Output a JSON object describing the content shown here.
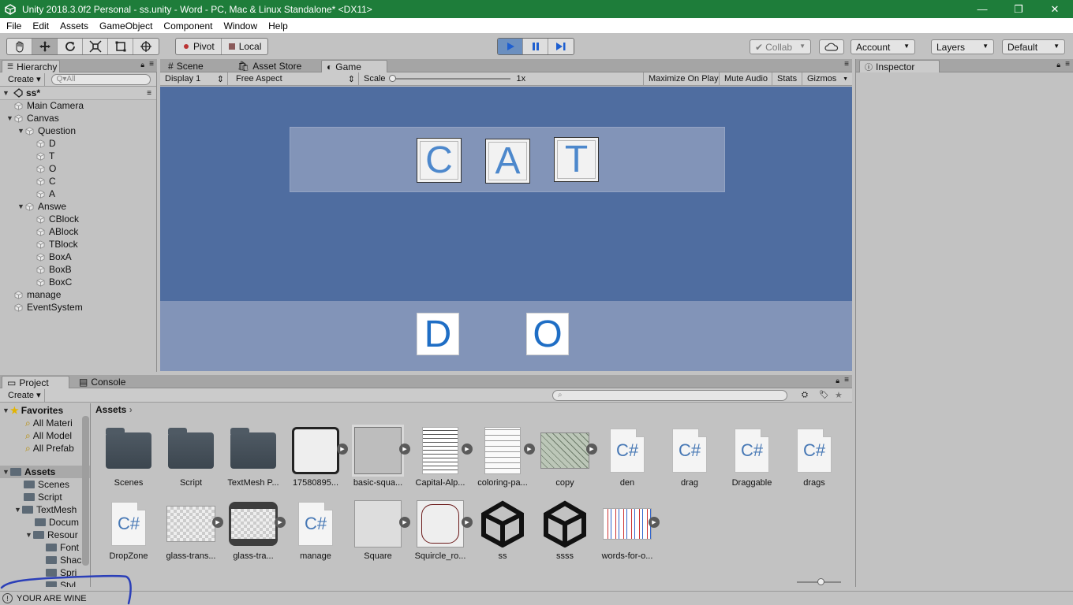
{
  "window": {
    "title": "Unity 2018.3.0f2 Personal - ss.unity - Word - PC, Mac & Linux Standalone* <DX11>",
    "minimize": "—",
    "maximize": "❐",
    "close": "✕"
  },
  "menu": [
    "File",
    "Edit",
    "Assets",
    "GameObject",
    "Component",
    "Window",
    "Help"
  ],
  "toolbar": {
    "pivot": "Pivot",
    "local": "Local",
    "collab": "Collab",
    "account": "Account",
    "layers": "Layers",
    "layout": "Default"
  },
  "hierarchy": {
    "tab": "Hierarchy",
    "create": "Create",
    "search_placeholder": "Q▾All",
    "scene": "ss*",
    "items": [
      {
        "label": "Main Camera",
        "depth": 1,
        "arrow": ""
      },
      {
        "label": "Canvas",
        "depth": 1,
        "arrow": "▼"
      },
      {
        "label": "Question",
        "depth": 2,
        "arrow": "▼"
      },
      {
        "label": "D",
        "depth": 3,
        "arrow": ""
      },
      {
        "label": "T",
        "depth": 3,
        "arrow": ""
      },
      {
        "label": "O",
        "depth": 3,
        "arrow": ""
      },
      {
        "label": "C",
        "depth": 3,
        "arrow": ""
      },
      {
        "label": "A",
        "depth": 3,
        "arrow": ""
      },
      {
        "label": "Answe",
        "depth": 2,
        "arrow": "▼"
      },
      {
        "label": "CBlock",
        "depth": 3,
        "arrow": ""
      },
      {
        "label": "ABlock",
        "depth": 3,
        "arrow": ""
      },
      {
        "label": "TBlock",
        "depth": 3,
        "arrow": ""
      },
      {
        "label": "BoxA",
        "depth": 3,
        "arrow": ""
      },
      {
        "label": "BoxB",
        "depth": 3,
        "arrow": ""
      },
      {
        "label": "BoxC",
        "depth": 3,
        "arrow": ""
      },
      {
        "label": "manage",
        "depth": 1,
        "arrow": ""
      },
      {
        "label": "EventSystem",
        "depth": 1,
        "arrow": ""
      }
    ]
  },
  "views": {
    "tabs": [
      "Scene",
      "Asset Store",
      "Game"
    ],
    "display": "Display 1",
    "aspect": "Free Aspect",
    "scale_label": "Scale",
    "scale_value": "1x",
    "maximize": "Maximize On Play",
    "mute": "Mute Audio",
    "stats": "Stats",
    "gizmos": "Gizmos"
  },
  "game": {
    "question_tiles": [
      "C",
      "A",
      "T"
    ],
    "answer_tiles": [
      "D",
      "O"
    ]
  },
  "inspector": {
    "tab": "Inspector"
  },
  "project": {
    "tabs": [
      "Project",
      "Console"
    ],
    "create": "Create",
    "breadcrumb": "Assets",
    "favorites": {
      "label": "Favorites",
      "items": [
        "All Materi",
        "All Model",
        "All Prefab"
      ]
    },
    "assets_root": "Assets",
    "folders": [
      "Scenes",
      "Script",
      "TextMesh",
      "Docum",
      "Resour",
      "Font",
      "Shac",
      "Spri",
      "Styl"
    ],
    "row1": [
      {
        "label": "Scenes",
        "kind": "folder"
      },
      {
        "label": "Script",
        "kind": "folder"
      },
      {
        "label": "TextMesh P...",
        "kind": "folder"
      },
      {
        "label": "17580895...",
        "kind": "sprite-frame"
      },
      {
        "label": "basic-squa...",
        "kind": "sprite-square"
      },
      {
        "label": "Capital-Alp...",
        "kind": "sprite-letters"
      },
      {
        "label": "coloring-pa...",
        "kind": "sprite-coloring"
      },
      {
        "label": "copy",
        "kind": "sprite-map"
      },
      {
        "label": "den",
        "kind": "csharp"
      },
      {
        "label": "drag",
        "kind": "csharp"
      },
      {
        "label": "Draggable",
        "kind": "csharp"
      },
      {
        "label": "drags",
        "kind": "csharp"
      }
    ],
    "row2": [
      {
        "label": "DropZone",
        "kind": "csharp"
      },
      {
        "label": "glass-trans...",
        "kind": "sprite-glass"
      },
      {
        "label": "glass-tra...",
        "kind": "sprite-glass-selected"
      },
      {
        "label": "manage",
        "kind": "csharp"
      },
      {
        "label": "Square",
        "kind": "sprite-plain"
      },
      {
        "label": "Squircle_ro...",
        "kind": "sprite-squircle"
      },
      {
        "label": "ss",
        "kind": "unity-scene"
      },
      {
        "label": "ssss",
        "kind": "unity-scene"
      },
      {
        "label": "words-for-o...",
        "kind": "sprite-words"
      }
    ],
    "csharp_glyph": "C#"
  },
  "status": {
    "message": "YOUR ARE WINE"
  },
  "colors": {
    "titlebar": "#1e7d3a",
    "game_bg": "#4f6da0",
    "panel_bg": "#8294b8",
    "accent_play": "#6b8fbf",
    "scribble": "#2b3fb8"
  }
}
